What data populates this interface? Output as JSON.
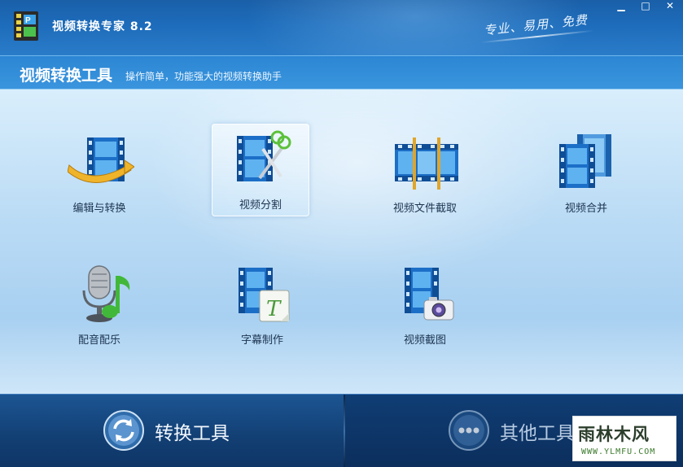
{
  "window": {
    "title": "视频转换专家 8.2",
    "slogan": "专业、易用、免费",
    "min_glyph": "▁",
    "max_glyph": "□",
    "close_glyph": "✕"
  },
  "header": {
    "title": "视频转换工具",
    "subtitle": "操作简单，功能强大的视频转换助手"
  },
  "tools": [
    {
      "label": "编辑与转换",
      "icon": "film-convert-icon"
    },
    {
      "label": "视频分割",
      "icon": "film-scissors-icon",
      "selected": true
    },
    {
      "label": "视频文件截取",
      "icon": "film-clip-icon"
    },
    {
      "label": "视频合并",
      "icon": "film-merge-icon"
    },
    {
      "label": "配音配乐",
      "icon": "microphone-music-icon"
    },
    {
      "label": "字幕制作",
      "icon": "film-subtitle-icon"
    },
    {
      "label": "视频截图",
      "icon": "film-camera-icon"
    }
  ],
  "bottom_tabs": {
    "convert_label": "转换工具",
    "other_label": "其他工具"
  },
  "watermark": {
    "text": "雨林木风",
    "url": "WWW.YLMFU.COM"
  },
  "colors": {
    "titlebar": "#1d6cbb",
    "header": "#3a95de",
    "content": "#bcdcf5",
    "bottom": "#0f3d74",
    "film_blue": "#1c6fc7"
  }
}
